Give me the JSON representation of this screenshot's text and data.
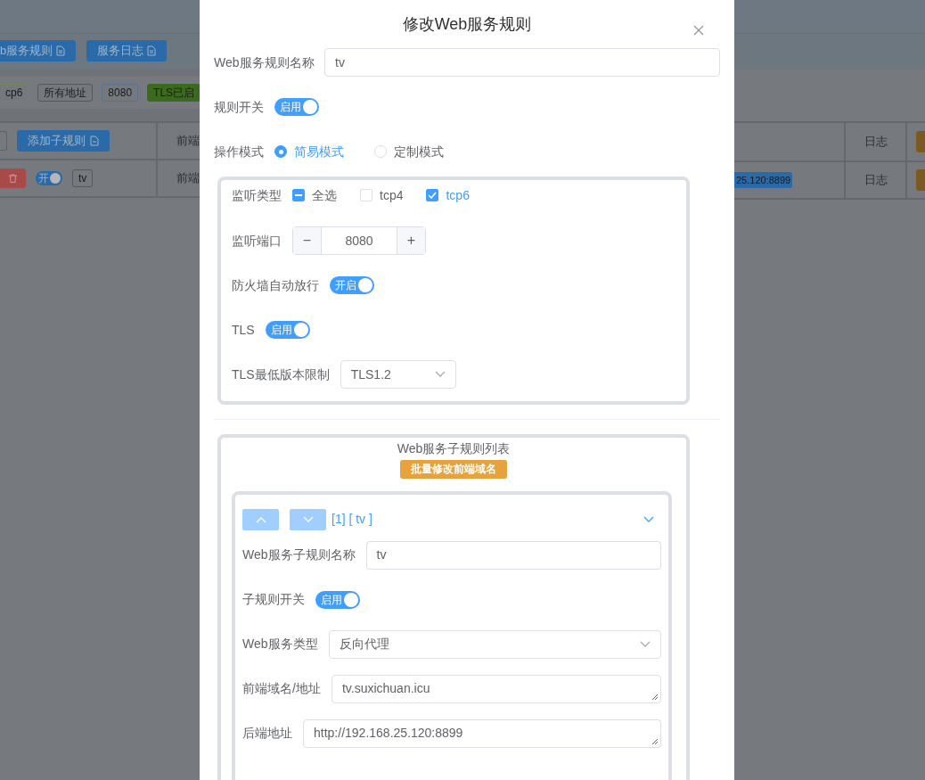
{
  "background": {
    "toolbar_buttons": [
      {
        "label": "b服务规则"
      },
      {
        "label": "服务日志"
      }
    ],
    "tags": [
      {
        "label": "cp6",
        "kind": "green"
      },
      {
        "label": "所有地址",
        "kind": "plain"
      },
      {
        "label": "8080",
        "kind": "blue"
      },
      {
        "label": "TLS已启",
        "kind": "filled"
      }
    ],
    "table": {
      "select_all": {
        "checked": false
      },
      "add_button": "添加子规则",
      "column_2": "前端",
      "column_3": "日志",
      "rows": [
        {
          "switch": {
            "label": "开",
            "on": true
          },
          "name": "tv",
          "column_2": "前端",
          "backend": "25.120:8899",
          "log": "日志"
        }
      ]
    }
  },
  "dialog": {
    "title": "修改Web服务规则",
    "rule_name": {
      "label": "Web服务规则名称",
      "value": "tv"
    },
    "rule_switch": {
      "label": "规则开关",
      "text": "启用",
      "on": true
    },
    "mode": {
      "label": "操作模式",
      "options": [
        {
          "label": "简易模式",
          "selected": true
        },
        {
          "label": "定制模式",
          "selected": false
        }
      ]
    },
    "listen_types": {
      "label": "监听类型",
      "options": [
        {
          "label": "全选",
          "checked": false,
          "indeterminate": true
        },
        {
          "label": "tcp4",
          "checked": false,
          "indeterminate": false
        },
        {
          "label": "tcp6",
          "checked": true,
          "indeterminate": false
        }
      ]
    },
    "listen_port": {
      "label": "监听端口",
      "value": "8080",
      "minus": "−",
      "plus": "+"
    },
    "firewall": {
      "label": "防火墙自动放行",
      "text": "开启",
      "on": true
    },
    "tls": {
      "label": "TLS",
      "text": "启用",
      "on": true
    },
    "tls_min": {
      "label": "TLS最低版本限制",
      "value": "TLS1.2"
    },
    "subrules": {
      "title": "Web服务子规则列表",
      "batch_button": "批量修改前端域名",
      "items": [
        {
          "header": "[1] [ tv ]",
          "expanded": true,
          "name": {
            "label": "Web服务子规则名称",
            "value": "tv"
          },
          "switch": {
            "label": "子规则开关",
            "text": "启用",
            "on": true
          },
          "type": {
            "label": "Web服务类型",
            "value": "反向代理"
          },
          "frontend": {
            "label": "前端域名/地址",
            "value": "tv.suxichuan.icu"
          },
          "backend": {
            "label": "后端地址",
            "value": "http://192.168.25.120:8899"
          }
        }
      ]
    }
  }
}
